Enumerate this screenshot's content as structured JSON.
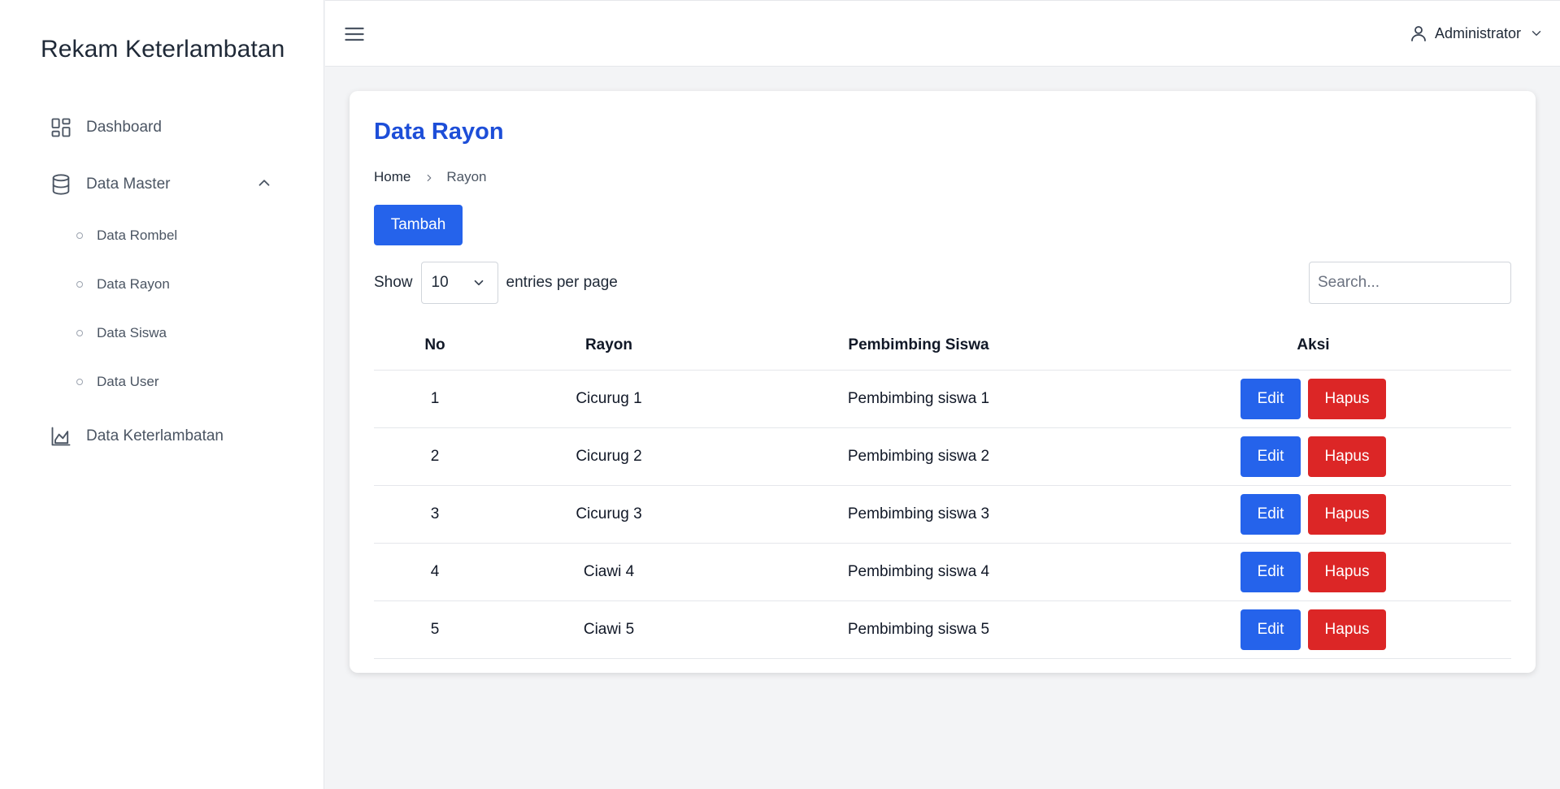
{
  "sidebar": {
    "brand": "Rekam Keterlambatan",
    "items": [
      {
        "label": "Dashboard",
        "icon": "dashboard-grid-icon"
      },
      {
        "label": "Data Master",
        "icon": "database-icon",
        "expanded": true
      },
      {
        "label": "Data Keterlambatan",
        "icon": "chart-area-icon"
      }
    ],
    "sub_items": [
      {
        "label": "Data Rombel"
      },
      {
        "label": "Data Rayon"
      },
      {
        "label": "Data Siswa"
      },
      {
        "label": "Data User"
      }
    ]
  },
  "topbar": {
    "user": "Administrator"
  },
  "page": {
    "title": "Data Rayon",
    "breadcrumb": {
      "home": "Home",
      "current": "Rayon"
    },
    "add_button": "Tambah",
    "show_label": "Show",
    "entries_value": "10",
    "entries_suffix": "entries per page",
    "search_placeholder": "Search..."
  },
  "table": {
    "headers": [
      "No",
      "Rayon",
      "Pembimbing Siswa",
      "Aksi"
    ],
    "edit_label": "Edit",
    "delete_label": "Hapus",
    "rows": [
      {
        "no": "1",
        "rayon": "Cicurug 1",
        "pembimbing": "Pembimbing siswa 1"
      },
      {
        "no": "2",
        "rayon": "Cicurug 2",
        "pembimbing": "Pembimbing siswa 2"
      },
      {
        "no": "3",
        "rayon": "Cicurug 3",
        "pembimbing": "Pembimbing siswa 3"
      },
      {
        "no": "4",
        "rayon": "Ciawi 4",
        "pembimbing": "Pembimbing siswa 4"
      },
      {
        "no": "5",
        "rayon": "Ciawi 5",
        "pembimbing": "Pembimbing siswa 5"
      }
    ]
  },
  "colors": {
    "primary": "#2563eb",
    "title": "#1d4ed8",
    "danger": "#dc2626",
    "background": "#f3f4f6"
  }
}
